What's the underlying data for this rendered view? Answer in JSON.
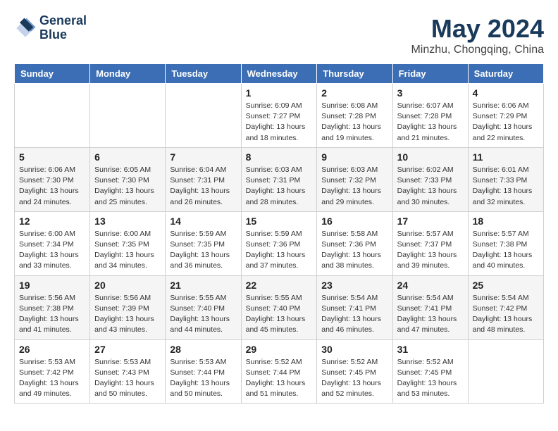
{
  "header": {
    "logo_line1": "General",
    "logo_line2": "Blue",
    "month": "May 2024",
    "location": "Minzhu, Chongqing, China"
  },
  "days_of_week": [
    "Sunday",
    "Monday",
    "Tuesday",
    "Wednesday",
    "Thursday",
    "Friday",
    "Saturday"
  ],
  "weeks": [
    [
      {
        "day": "",
        "info": ""
      },
      {
        "day": "",
        "info": ""
      },
      {
        "day": "",
        "info": ""
      },
      {
        "day": "1",
        "info": "Sunrise: 6:09 AM\nSunset: 7:27 PM\nDaylight: 13 hours and 18 minutes."
      },
      {
        "day": "2",
        "info": "Sunrise: 6:08 AM\nSunset: 7:28 PM\nDaylight: 13 hours and 19 minutes."
      },
      {
        "day": "3",
        "info": "Sunrise: 6:07 AM\nSunset: 7:28 PM\nDaylight: 13 hours and 21 minutes."
      },
      {
        "day": "4",
        "info": "Sunrise: 6:06 AM\nSunset: 7:29 PM\nDaylight: 13 hours and 22 minutes."
      }
    ],
    [
      {
        "day": "5",
        "info": "Sunrise: 6:06 AM\nSunset: 7:30 PM\nDaylight: 13 hours and 24 minutes."
      },
      {
        "day": "6",
        "info": "Sunrise: 6:05 AM\nSunset: 7:30 PM\nDaylight: 13 hours and 25 minutes."
      },
      {
        "day": "7",
        "info": "Sunrise: 6:04 AM\nSunset: 7:31 PM\nDaylight: 13 hours and 26 minutes."
      },
      {
        "day": "8",
        "info": "Sunrise: 6:03 AM\nSunset: 7:31 PM\nDaylight: 13 hours and 28 minutes."
      },
      {
        "day": "9",
        "info": "Sunrise: 6:03 AM\nSunset: 7:32 PM\nDaylight: 13 hours and 29 minutes."
      },
      {
        "day": "10",
        "info": "Sunrise: 6:02 AM\nSunset: 7:33 PM\nDaylight: 13 hours and 30 minutes."
      },
      {
        "day": "11",
        "info": "Sunrise: 6:01 AM\nSunset: 7:33 PM\nDaylight: 13 hours and 32 minutes."
      }
    ],
    [
      {
        "day": "12",
        "info": "Sunrise: 6:00 AM\nSunset: 7:34 PM\nDaylight: 13 hours and 33 minutes."
      },
      {
        "day": "13",
        "info": "Sunrise: 6:00 AM\nSunset: 7:35 PM\nDaylight: 13 hours and 34 minutes."
      },
      {
        "day": "14",
        "info": "Sunrise: 5:59 AM\nSunset: 7:35 PM\nDaylight: 13 hours and 36 minutes."
      },
      {
        "day": "15",
        "info": "Sunrise: 5:59 AM\nSunset: 7:36 PM\nDaylight: 13 hours and 37 minutes."
      },
      {
        "day": "16",
        "info": "Sunrise: 5:58 AM\nSunset: 7:36 PM\nDaylight: 13 hours and 38 minutes."
      },
      {
        "day": "17",
        "info": "Sunrise: 5:57 AM\nSunset: 7:37 PM\nDaylight: 13 hours and 39 minutes."
      },
      {
        "day": "18",
        "info": "Sunrise: 5:57 AM\nSunset: 7:38 PM\nDaylight: 13 hours and 40 minutes."
      }
    ],
    [
      {
        "day": "19",
        "info": "Sunrise: 5:56 AM\nSunset: 7:38 PM\nDaylight: 13 hours and 41 minutes."
      },
      {
        "day": "20",
        "info": "Sunrise: 5:56 AM\nSunset: 7:39 PM\nDaylight: 13 hours and 43 minutes."
      },
      {
        "day": "21",
        "info": "Sunrise: 5:55 AM\nSunset: 7:40 PM\nDaylight: 13 hours and 44 minutes."
      },
      {
        "day": "22",
        "info": "Sunrise: 5:55 AM\nSunset: 7:40 PM\nDaylight: 13 hours and 45 minutes."
      },
      {
        "day": "23",
        "info": "Sunrise: 5:54 AM\nSunset: 7:41 PM\nDaylight: 13 hours and 46 minutes."
      },
      {
        "day": "24",
        "info": "Sunrise: 5:54 AM\nSunset: 7:41 PM\nDaylight: 13 hours and 47 minutes."
      },
      {
        "day": "25",
        "info": "Sunrise: 5:54 AM\nSunset: 7:42 PM\nDaylight: 13 hours and 48 minutes."
      }
    ],
    [
      {
        "day": "26",
        "info": "Sunrise: 5:53 AM\nSunset: 7:42 PM\nDaylight: 13 hours and 49 minutes."
      },
      {
        "day": "27",
        "info": "Sunrise: 5:53 AM\nSunset: 7:43 PM\nDaylight: 13 hours and 50 minutes."
      },
      {
        "day": "28",
        "info": "Sunrise: 5:53 AM\nSunset: 7:44 PM\nDaylight: 13 hours and 50 minutes."
      },
      {
        "day": "29",
        "info": "Sunrise: 5:52 AM\nSunset: 7:44 PM\nDaylight: 13 hours and 51 minutes."
      },
      {
        "day": "30",
        "info": "Sunrise: 5:52 AM\nSunset: 7:45 PM\nDaylight: 13 hours and 52 minutes."
      },
      {
        "day": "31",
        "info": "Sunrise: 5:52 AM\nSunset: 7:45 PM\nDaylight: 13 hours and 53 minutes."
      },
      {
        "day": "",
        "info": ""
      }
    ]
  ]
}
